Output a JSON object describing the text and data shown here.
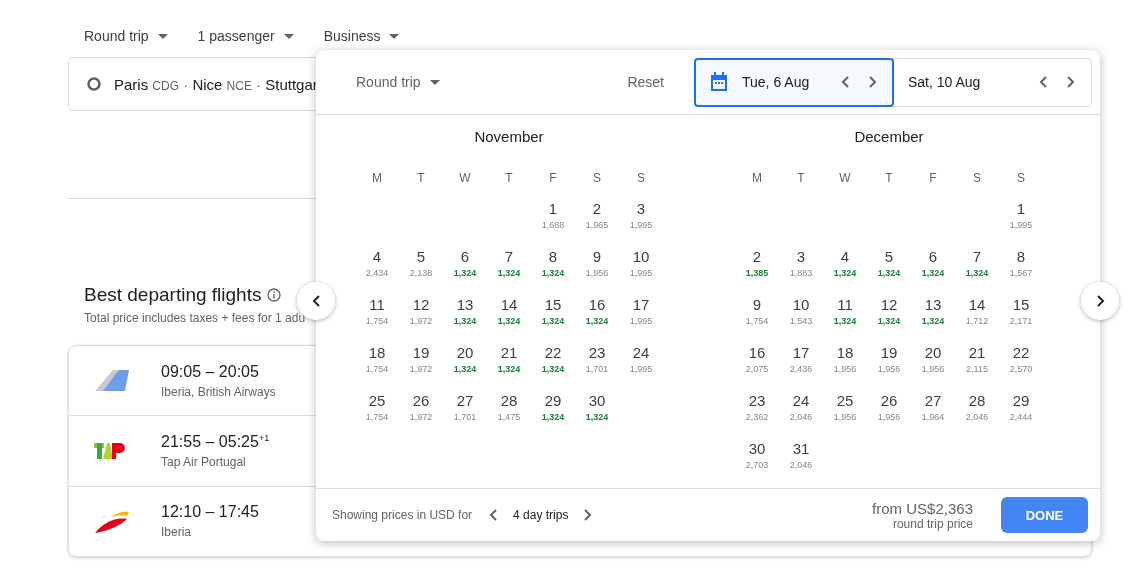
{
  "top_bar": {
    "dropdowns": [
      "Round trip",
      "1 passenger",
      "Business"
    ]
  },
  "search_field": {
    "segments": [
      {
        "text": "Paris",
        "kind": "city"
      },
      {
        "text": "CDG",
        "kind": "code"
      },
      {
        "text": "·",
        "kind": "sep"
      },
      {
        "text": "Nice",
        "kind": "city"
      },
      {
        "text": "NCE",
        "kind": "code"
      },
      {
        "text": "·",
        "kind": "sep"
      },
      {
        "text": "Stuttgar",
        "kind": "city"
      }
    ]
  },
  "results": {
    "title": "Best departing flights",
    "subtitle": "Total price includes taxes + fees for 1 adu",
    "flights": [
      {
        "times": "09:05 – 20:05",
        "airline": "Iberia, British Airways"
      },
      {
        "times": "21:55 – 05:25$^{+1}$",
        "airline": "Tap Air Portugal"
      },
      {
        "times": "12:10 – 17:45",
        "airline": "Iberia"
      }
    ]
  },
  "date_picker": {
    "trip_type": "Round trip",
    "reset": "Reset",
    "dates": [
      {
        "value": "Tue, 6 Aug",
        "selected": true
      },
      {
        "value": "Sat, 10 Aug",
        "selected": false
      }
    ],
    "months": [
      {
        "name": "November",
        "weekdays": [
          "M",
          "T",
          "W",
          "T",
          "F",
          "S",
          "S"
        ],
        "weeks": [
          [
            {
              "day": "1",
              "price": "1,688",
              "cheap": false
            },
            {
              "day": "2",
              "price": "1,965",
              "cheap": false
            },
            {
              "day": "3",
              "price": "1,995",
              "cheap": false
            }
          ],
          [
            {
              "day": "4",
              "price": "2,434",
              "cheap": false
            },
            {
              "day": "5",
              "price": "2,138",
              "cheap": false
            },
            {
              "day": "6",
              "price": "1,324",
              "cheap": true
            },
            {
              "day": "7",
              "price": "1,324",
              "cheap": true
            },
            {
              "day": "8",
              "price": "1,324",
              "cheap": true
            },
            {
              "day": "9",
              "price": "1,956",
              "cheap": false
            },
            {
              "day": "10",
              "price": "1,995",
              "cheap": false
            }
          ],
          [
            {
              "day": "11",
              "price": "1,754",
              "cheap": false
            },
            {
              "day": "12",
              "price": "1,972",
              "cheap": false
            },
            {
              "day": "13",
              "price": "1,324",
              "cheap": true
            },
            {
              "day": "14",
              "price": "1,324",
              "cheap": true
            },
            {
              "day": "15",
              "price": "1,324",
              "cheap": true
            },
            {
              "day": "16",
              "price": "1,324",
              "cheap": true
            },
            {
              "day": "17",
              "price": "1,995",
              "cheap": false
            }
          ],
          [
            {
              "day": "18",
              "price": "1,754",
              "cheap": false
            },
            {
              "day": "19",
              "price": "1,972",
              "cheap": false
            },
            {
              "day": "20",
              "price": "1,324",
              "cheap": true
            },
            {
              "day": "21",
              "price": "1,324",
              "cheap": true
            },
            {
              "day": "22",
              "price": "1,324",
              "cheap": true
            },
            {
              "day": "23",
              "price": "1,701",
              "cheap": false
            },
            {
              "day": "24",
              "price": "1,995",
              "cheap": false
            }
          ],
          [
            {
              "day": "25",
              "price": "1,754",
              "cheap": false
            },
            {
              "day": "26",
              "price": "1,972",
              "cheap": false
            },
            {
              "day": "27",
              "price": "1,701",
              "cheap": false
            },
            {
              "day": "28",
              "price": "1,475",
              "cheap": false
            },
            {
              "day": "29",
              "price": "1,324",
              "cheap": true
            },
            {
              "day": "30",
              "price": "1,324",
              "cheap": true
            }
          ]
        ]
      },
      {
        "name": "December",
        "weekdays": [
          "M",
          "T",
          "W",
          "T",
          "F",
          "S",
          "S"
        ],
        "weeks": [
          [
            {
              "day": "1",
              "price": "1,995",
              "cheap": false
            }
          ],
          [
            {
              "day": "2",
              "price": "1,385",
              "cheap": true
            },
            {
              "day": "3",
              "price": "1,883",
              "cheap": false
            },
            {
              "day": "4",
              "price": "1,324",
              "cheap": true
            },
            {
              "day": "5",
              "price": "1,324",
              "cheap": true
            },
            {
              "day": "6",
              "price": "1,324",
              "cheap": true
            },
            {
              "day": "7",
              "price": "1,324",
              "cheap": true
            },
            {
              "day": "8",
              "price": "1,567",
              "cheap": false
            }
          ],
          [
            {
              "day": "9",
              "price": "1,754",
              "cheap": false
            },
            {
              "day": "10",
              "price": "1,543",
              "cheap": false
            },
            {
              "day": "11",
              "price": "1,324",
              "cheap": true
            },
            {
              "day": "12",
              "price": "1,324",
              "cheap": true
            },
            {
              "day": "13",
              "price": "1,324",
              "cheap": true
            },
            {
              "day": "14",
              "price": "1,712",
              "cheap": false
            },
            {
              "day": "15",
              "price": "2,171",
              "cheap": false
            }
          ],
          [
            {
              "day": "16",
              "price": "2,075",
              "cheap": false
            },
            {
              "day": "17",
              "price": "2,436",
              "cheap": false
            },
            {
              "day": "18",
              "price": "1,956",
              "cheap": false
            },
            {
              "day": "19",
              "price": "1,956",
              "cheap": false
            },
            {
              "day": "20",
              "price": "1,956",
              "cheap": false
            },
            {
              "day": "21",
              "price": "2,115",
              "cheap": false
            },
            {
              "day": "22",
              "price": "2,570",
              "cheap": false
            }
          ],
          [
            {
              "day": "23",
              "price": "2,362",
              "cheap": false
            },
            {
              "day": "24",
              "price": "2,046",
              "cheap": false
            },
            {
              "day": "25",
              "price": "1,956",
              "cheap": false
            },
            {
              "day": "26",
              "price": "1,956",
              "cheap": false
            },
            {
              "day": "27",
              "price": "1,964",
              "cheap": false
            },
            {
              "day": "28",
              "price": "2,046",
              "cheap": false
            },
            {
              "day": "29",
              "price": "2,444",
              "cheap": false
            }
          ],
          [
            {
              "day": "30",
              "price": "2,703",
              "cheap": false
            },
            {
              "day": "31",
              "price": "2,046",
              "cheap": false
            }
          ]
        ]
      }
    ],
    "footer": {
      "note": "Showing prices in USD for",
      "trip_length": "4 day trips",
      "price": "from US$2,363",
      "price_note": "round trip price",
      "done": "DONE"
    }
  }
}
